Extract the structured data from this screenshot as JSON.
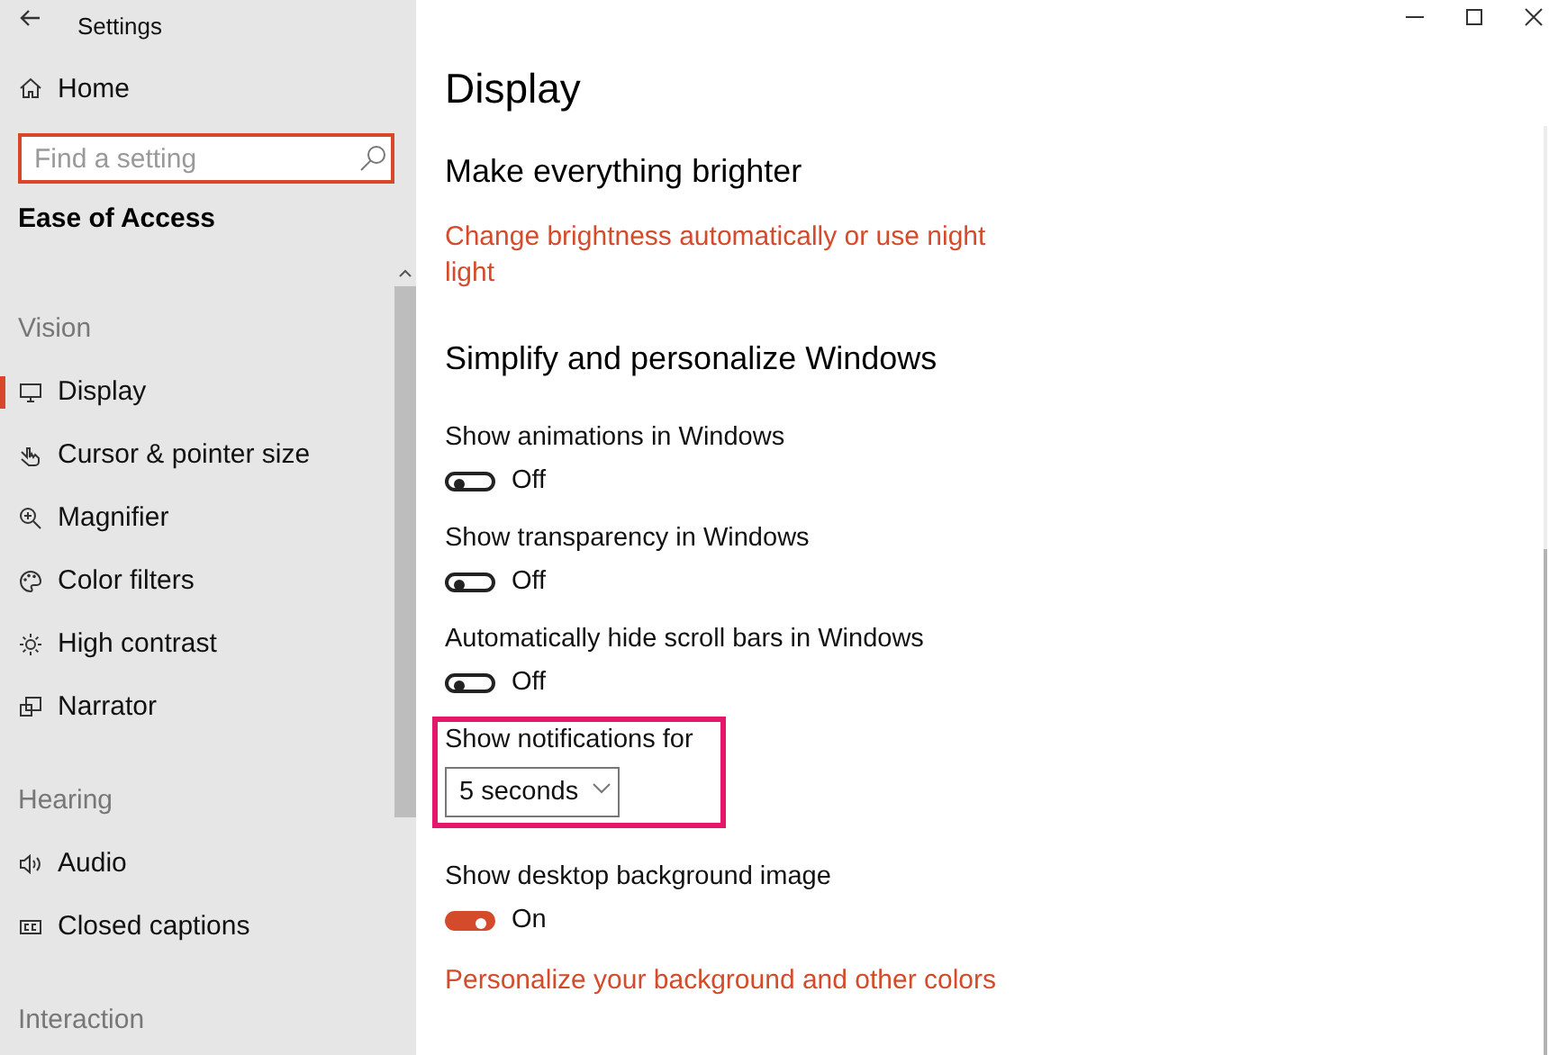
{
  "window": {
    "title": "Settings"
  },
  "sidebar": {
    "home": "Home",
    "search": {
      "placeholder": "Find a setting"
    },
    "section": "Ease of Access",
    "groups": [
      {
        "header": "Vision",
        "items": [
          {
            "label": "Display",
            "selected": true
          },
          {
            "label": "Cursor & pointer size",
            "selected": false
          },
          {
            "label": "Magnifier",
            "selected": false
          },
          {
            "label": "Color filters",
            "selected": false
          },
          {
            "label": "High contrast",
            "selected": false
          },
          {
            "label": "Narrator",
            "selected": false
          }
        ]
      },
      {
        "header": "Hearing",
        "items": [
          {
            "label": "Audio",
            "selected": false
          },
          {
            "label": "Closed captions",
            "selected": false
          }
        ]
      },
      {
        "header": "Interaction"
      }
    ]
  },
  "page": {
    "title": "Display",
    "sections": [
      {
        "heading": "Make everything brighter",
        "settings": [
          {
            "kind": "link",
            "text": "Change brightness automatically or use night light"
          }
        ]
      },
      {
        "heading": "Simplify and personalize Windows",
        "settings": [
          {
            "kind": "toggle",
            "label": "Show animations in Windows",
            "on": false,
            "state": "Off"
          },
          {
            "kind": "toggle",
            "label": "Show transparency in Windows",
            "on": false,
            "state": "Off"
          },
          {
            "kind": "toggle",
            "label": "Automatically hide scroll bars in Windows",
            "on": false,
            "state": "Off"
          },
          {
            "kind": "dropdown",
            "label": "Show notifications for",
            "value": "5 seconds",
            "highlighted": true
          },
          {
            "kind": "toggle",
            "label": "Show desktop background image",
            "on": true,
            "state": "On"
          },
          {
            "kind": "link",
            "text": "Personalize your background and other colors"
          }
        ]
      }
    ]
  }
}
